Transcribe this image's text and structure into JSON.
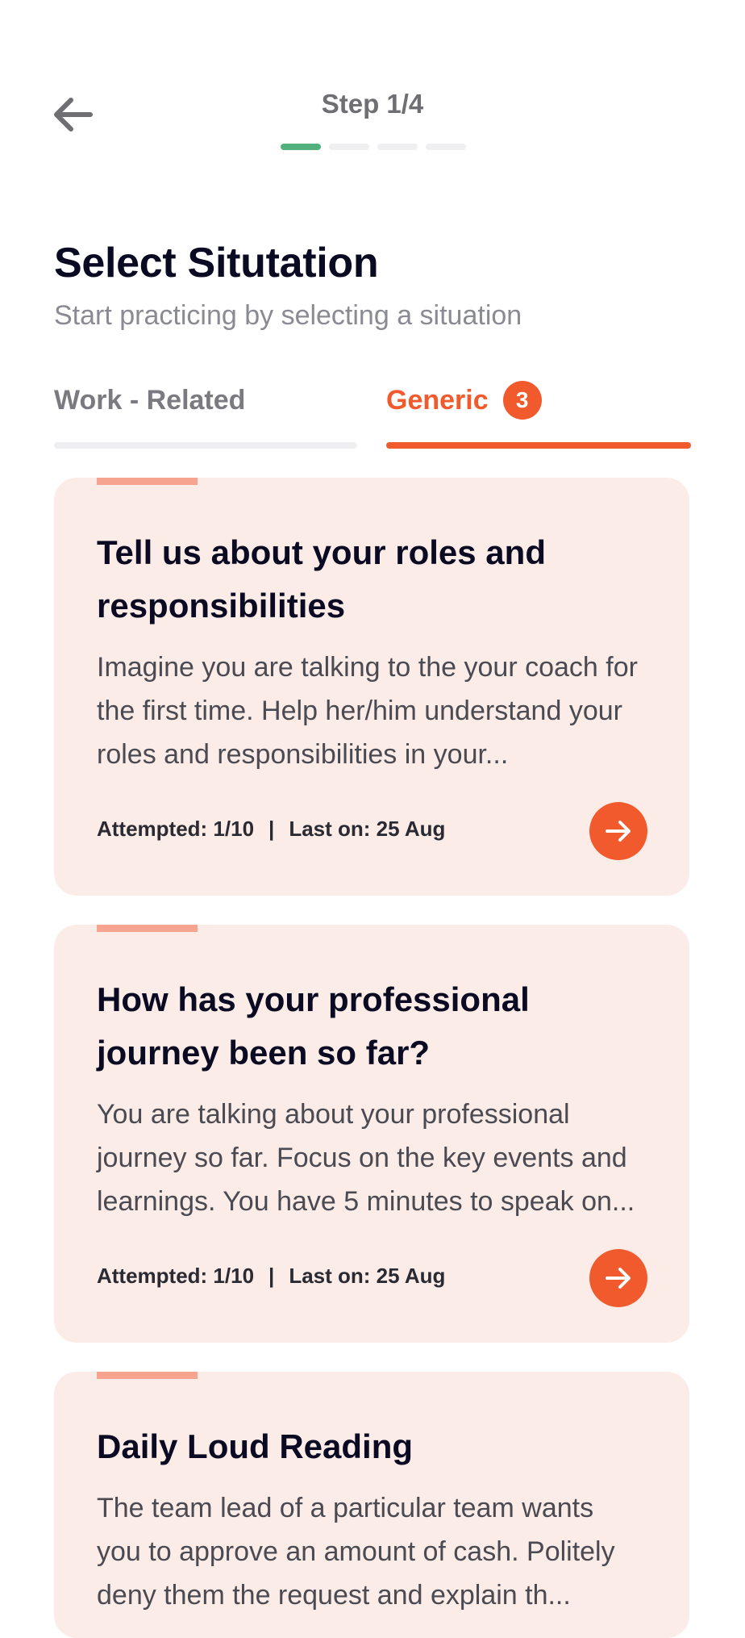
{
  "header": {
    "step_label": "Step 1/4",
    "steps_total": 4,
    "steps_completed": 1
  },
  "page": {
    "title": "Select Situtation",
    "subtitle": "Start practicing by selecting a situation"
  },
  "tabs": [
    {
      "label": "Work - Related",
      "active": false
    },
    {
      "label": "Generic",
      "badge": "3",
      "active": true
    }
  ],
  "cards": [
    {
      "title": "Tell us about your roles and responsibilities",
      "description": "Imagine you are talking to the your coach for the first time. Help her/him understand your roles and responsibilities in your...",
      "attempted": "Attempted: 1/10",
      "separator": "|",
      "last_on": "Last on: 25 Aug"
    },
    {
      "title": "How has your professional journey been so far?",
      "description": "You are talking about your professional journey so far. Focus on the key events and learnings. You have 5 minutes to speak on...",
      "attempted": "Attempted: 1/10",
      "separator": "|",
      "last_on": "Last on: 25 Aug"
    },
    {
      "title": "Daily Loud Reading",
      "description": "The team lead of a particular team wants you to approve an amount of cash. Politely deny them the request and explain th..."
    }
  ],
  "icons": {
    "back": "arrow-left-icon",
    "go": "arrow-right-icon"
  },
  "colors": {
    "accent": "#F05A2C",
    "step_active": "#52B07D",
    "card_bg": "#FCECE8",
    "card_accent": "#F6A38F"
  }
}
